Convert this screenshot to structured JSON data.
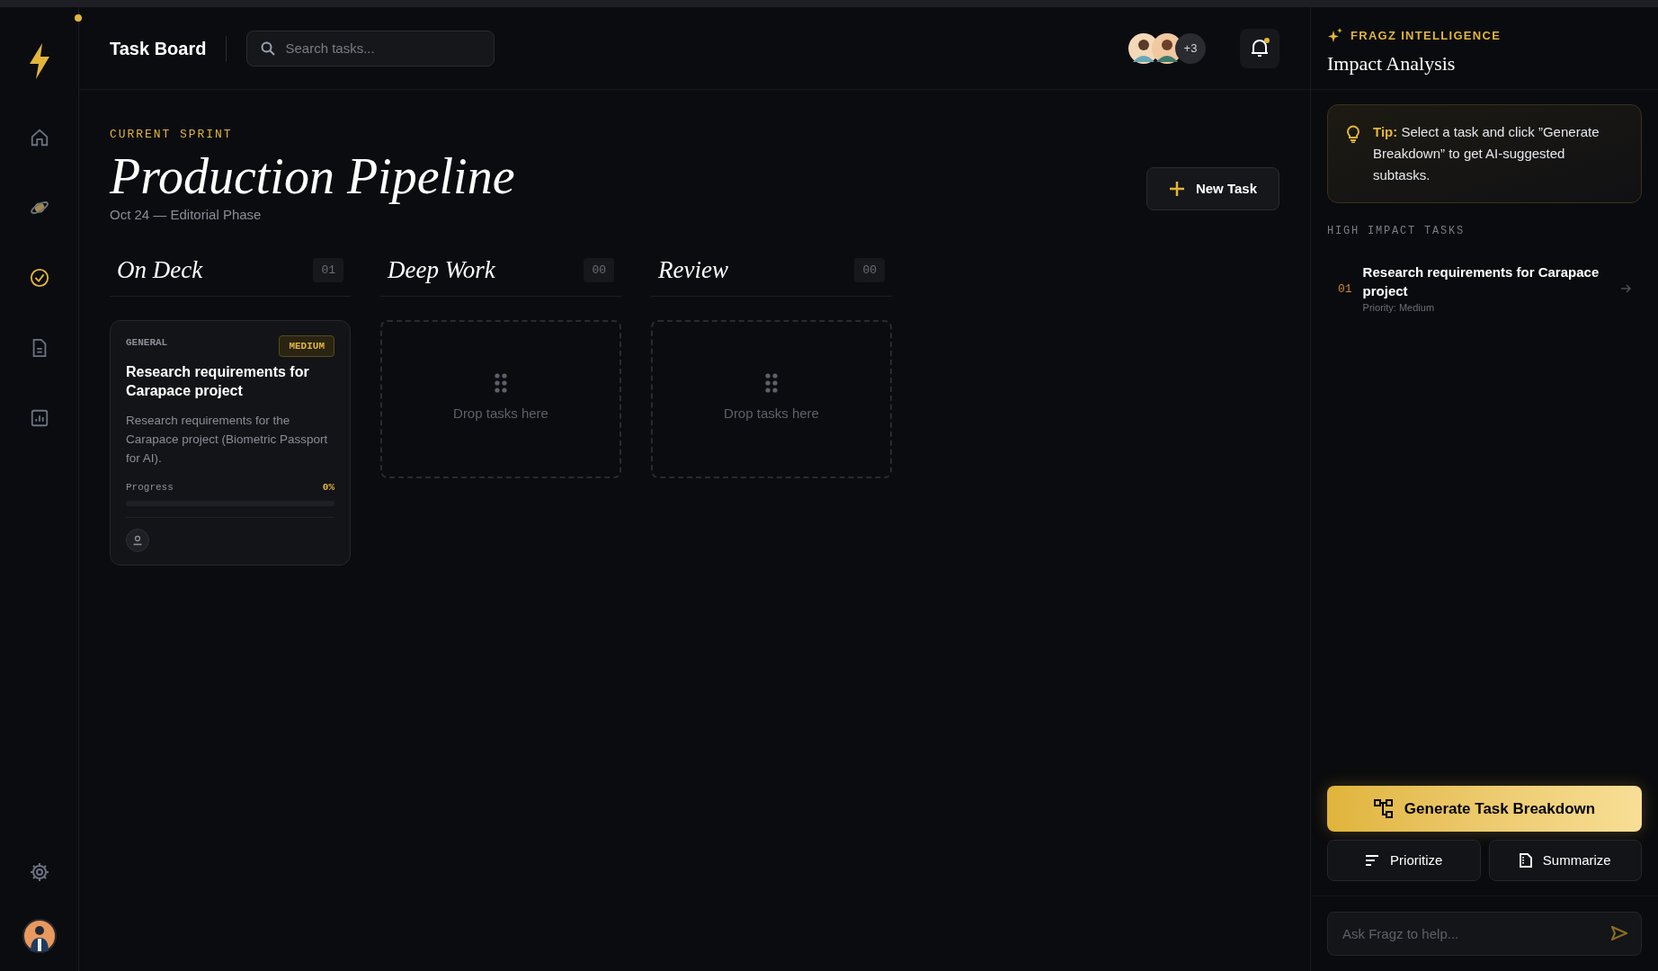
{
  "sidebar": {
    "nav": [
      {
        "kind": "home",
        "selected": false
      },
      {
        "kind": "planet",
        "selected": false
      },
      {
        "kind": "check",
        "selected": true
      },
      {
        "kind": "document",
        "selected": false
      },
      {
        "kind": "chart",
        "selected": false
      }
    ]
  },
  "header": {
    "title": "Task Board",
    "search": {
      "placeholder": "Search tasks..."
    },
    "collaborators_more": "+3",
    "notifications_unread": true
  },
  "sprint": {
    "eyebrow": "CURRENT SPRINT",
    "title": "Production Pipeline",
    "subtitle": "Oct 24 — Editorial Phase",
    "new_task_button": "New Task"
  },
  "columns": [
    {
      "title": "On Deck",
      "count": "01",
      "cards": [
        {
          "category": "GENERAL",
          "priority": "MEDIUM",
          "title": "Research requirements for Carapace project",
          "description": "Research requirements for the Carapace project (Biometric Passport for AI).",
          "progress_label": "Progress",
          "progress_reading": "0%"
        }
      ]
    },
    {
      "title": "Deep Work",
      "count": "00",
      "empty_text": "Drop tasks here"
    },
    {
      "title": "Review",
      "count": "00",
      "empty_text": "Drop tasks here"
    }
  ],
  "assistant": {
    "eyebrow": "FRAGZ INTELLIGENCE",
    "title": "Impact Analysis",
    "tip": "**Tip:** Select a task and click ”Generate Breakdown” to get AI-suggested subtasks.",
    "section_title": "HIGH IMPACT TASKS",
    "high_impact_tasks": [
      {
        "index": "01",
        "title": "Research requirements for Carapace project",
        "priority": "Priority: Medium"
      }
    ],
    "primary_action": "Generate Task Breakdown",
    "secondary_actions": [
      {
        "kind": "prioritize",
        "label": "Prioritize"
      },
      {
        "kind": "summarize",
        "label": "Summarize"
      }
    ],
    "chat": {
      "placeholder": "Ask Fragz to help..."
    }
  }
}
